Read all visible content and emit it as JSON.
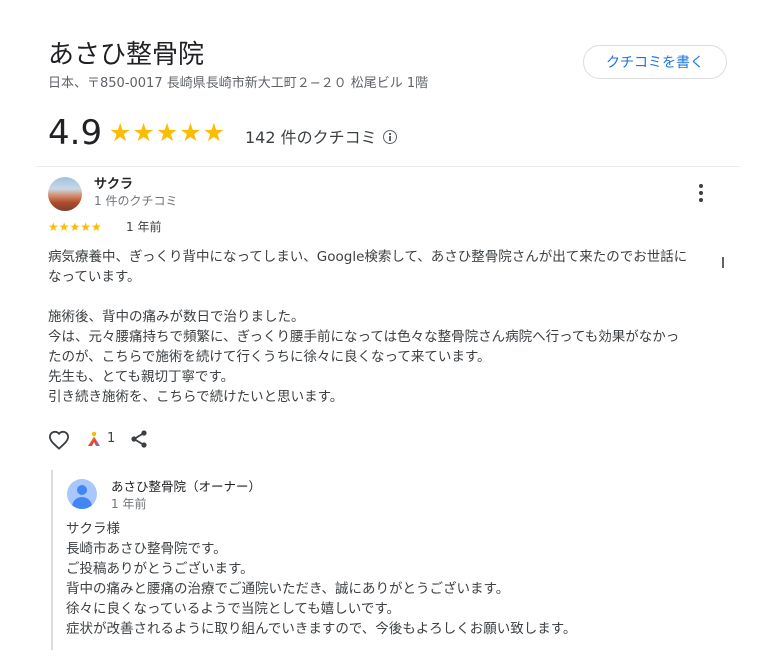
{
  "business": {
    "name": "あさひ整骨院",
    "address": "日本、〒850-0017 長崎県長崎市新大工町２−２０ 松尾ビル 1階",
    "write_review_label": "クチコミを書く",
    "rating": "4.9",
    "stars": "★★★★★",
    "review_count_text": "142 件のクチコミ"
  },
  "review": {
    "author": "サクラ",
    "author_meta": "1 件のクチコミ",
    "stars": "★★★★★",
    "time": "1 年前",
    "lines": [
      "病気療養中、ぎっくり背中になってしまい、Google検索して、あさひ整骨院さんが出て来たのでお世話に",
      "なっています。",
      "",
      "施術後、背中の痛みが数日で治りました。",
      "今は、元々腰痛持ちで頻繁に、ぎっくり腰手前になっては色々な整骨院さん病院へ行っても効果がなかっ",
      "たのが、こちらで施術を続けて行くうちに徐々に良くなって来ています。",
      "先生も、とても親切丁寧です。",
      "引き続き施術を、こちらで続けたいと思います。"
    ],
    "helpful_count": "1"
  },
  "owner_response": {
    "author": "あさひ整骨院（オーナー）",
    "time": "1 年前",
    "lines": [
      "サクラ様",
      "長崎市あさひ整骨院です。",
      "ご投稿ありがとうございます。",
      "背中の痛みと腰痛の治療でご通院いただき、誠にありがとうございます。",
      "徐々に良くなっているようで当院としても嬉しいです。",
      "症状が改善されるように取り組んでいきますので、今後もよろしくお願い致します。"
    ]
  },
  "icons": {
    "info": "info-icon",
    "more": "more-vert-icon",
    "like": "heart-icon",
    "helpful": "helpful-icon",
    "share": "share-icon",
    "owner_avatar": "person-avatar-icon"
  },
  "colors": {
    "star": "#fbbc04",
    "link": "#1a73e8",
    "owner_avatar": "#4285f4",
    "helpful_gradient": [
      "#fbbc04",
      "#ea4335",
      "#4285f4"
    ]
  }
}
